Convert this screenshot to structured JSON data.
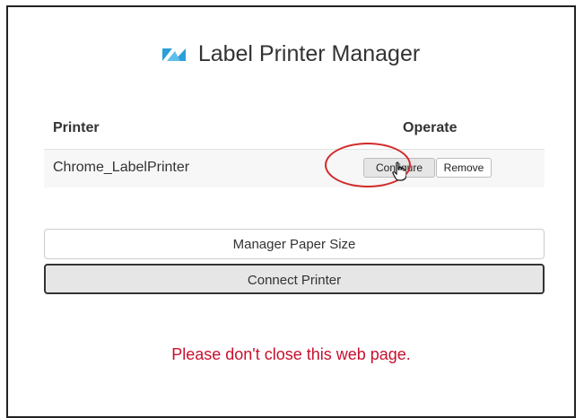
{
  "header": {
    "title": "Label Printer Manager",
    "logo": "label-printer-logo-icon"
  },
  "table": {
    "headers": {
      "printer": "Printer",
      "operate": "Operate"
    },
    "rows": [
      {
        "printer": "Chrome_LabelPrinter",
        "configure_label": "Configure",
        "remove_label": "Remove"
      }
    ]
  },
  "buttons": {
    "paper_size": "Manager Paper Size",
    "connect": "Connect Printer"
  },
  "warning": "Please don't close this web page.",
  "colors": {
    "accent": "#2b9fd9",
    "warning": "#c8102e",
    "highlight": "#d22a2a"
  }
}
